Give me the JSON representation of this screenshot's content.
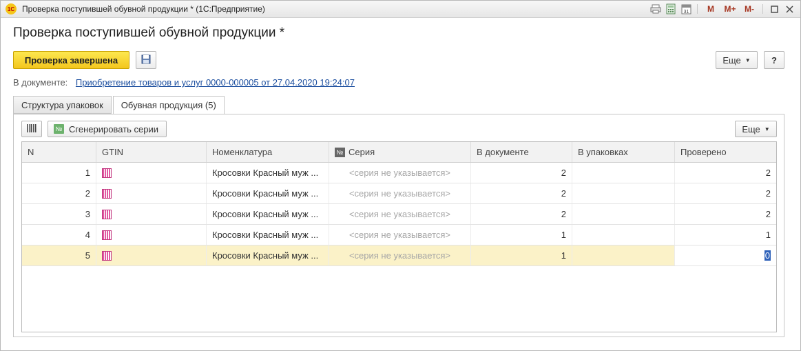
{
  "window": {
    "title": "Проверка поступившей обувной продукции * (1С:Предприятие)",
    "logo": "1С",
    "icons": [
      "print-icon",
      "calculator-icon",
      "calendar-icon"
    ],
    "m_buttons": [
      "M",
      "M+",
      "M-"
    ]
  },
  "form": {
    "title": "Проверка поступившей обувной продукции *",
    "primary_button": "Проверка завершена",
    "more_button": "Еще",
    "help_button": "?",
    "doc_label": "В документе:",
    "doc_link": "Приобретение товаров и услуг 0000-000005 от 27.04.2020 19:24:07"
  },
  "tabs": [
    {
      "label": "Структура упаковок",
      "active": false
    },
    {
      "label": "Обувная продукция (5)",
      "active": true
    }
  ],
  "panel": {
    "generate_button": "Сгенерировать серии",
    "generate_icon": "№",
    "more_button": "Еще"
  },
  "table": {
    "columns": [
      "N",
      "GTIN",
      "Номенклатура",
      "Серия",
      "В документе",
      "В упаковках",
      "Проверено"
    ],
    "series_icon": "№",
    "rows": [
      {
        "n": "1",
        "nom": "Кросовки Красный муж ...",
        "series": "<серия не указывается>",
        "doc": "2",
        "pack": "",
        "checked": "2"
      },
      {
        "n": "2",
        "nom": "Кросовки Красный муж ...",
        "series": "<серия не указывается>",
        "doc": "2",
        "pack": "",
        "checked": "2"
      },
      {
        "n": "3",
        "nom": "Кросовки Красный муж ...",
        "series": "<серия не указывается>",
        "doc": "2",
        "pack": "",
        "checked": "2"
      },
      {
        "n": "4",
        "nom": "Кросовки Красный муж ...",
        "series": "<серия не указывается>",
        "doc": "1",
        "pack": "",
        "checked": "1"
      },
      {
        "n": "5",
        "nom": "Кросовки Красный муж ...",
        "series": "<серия не указывается>",
        "doc": "1",
        "pack": "",
        "checked": "0"
      }
    ],
    "selected_row": 4
  }
}
